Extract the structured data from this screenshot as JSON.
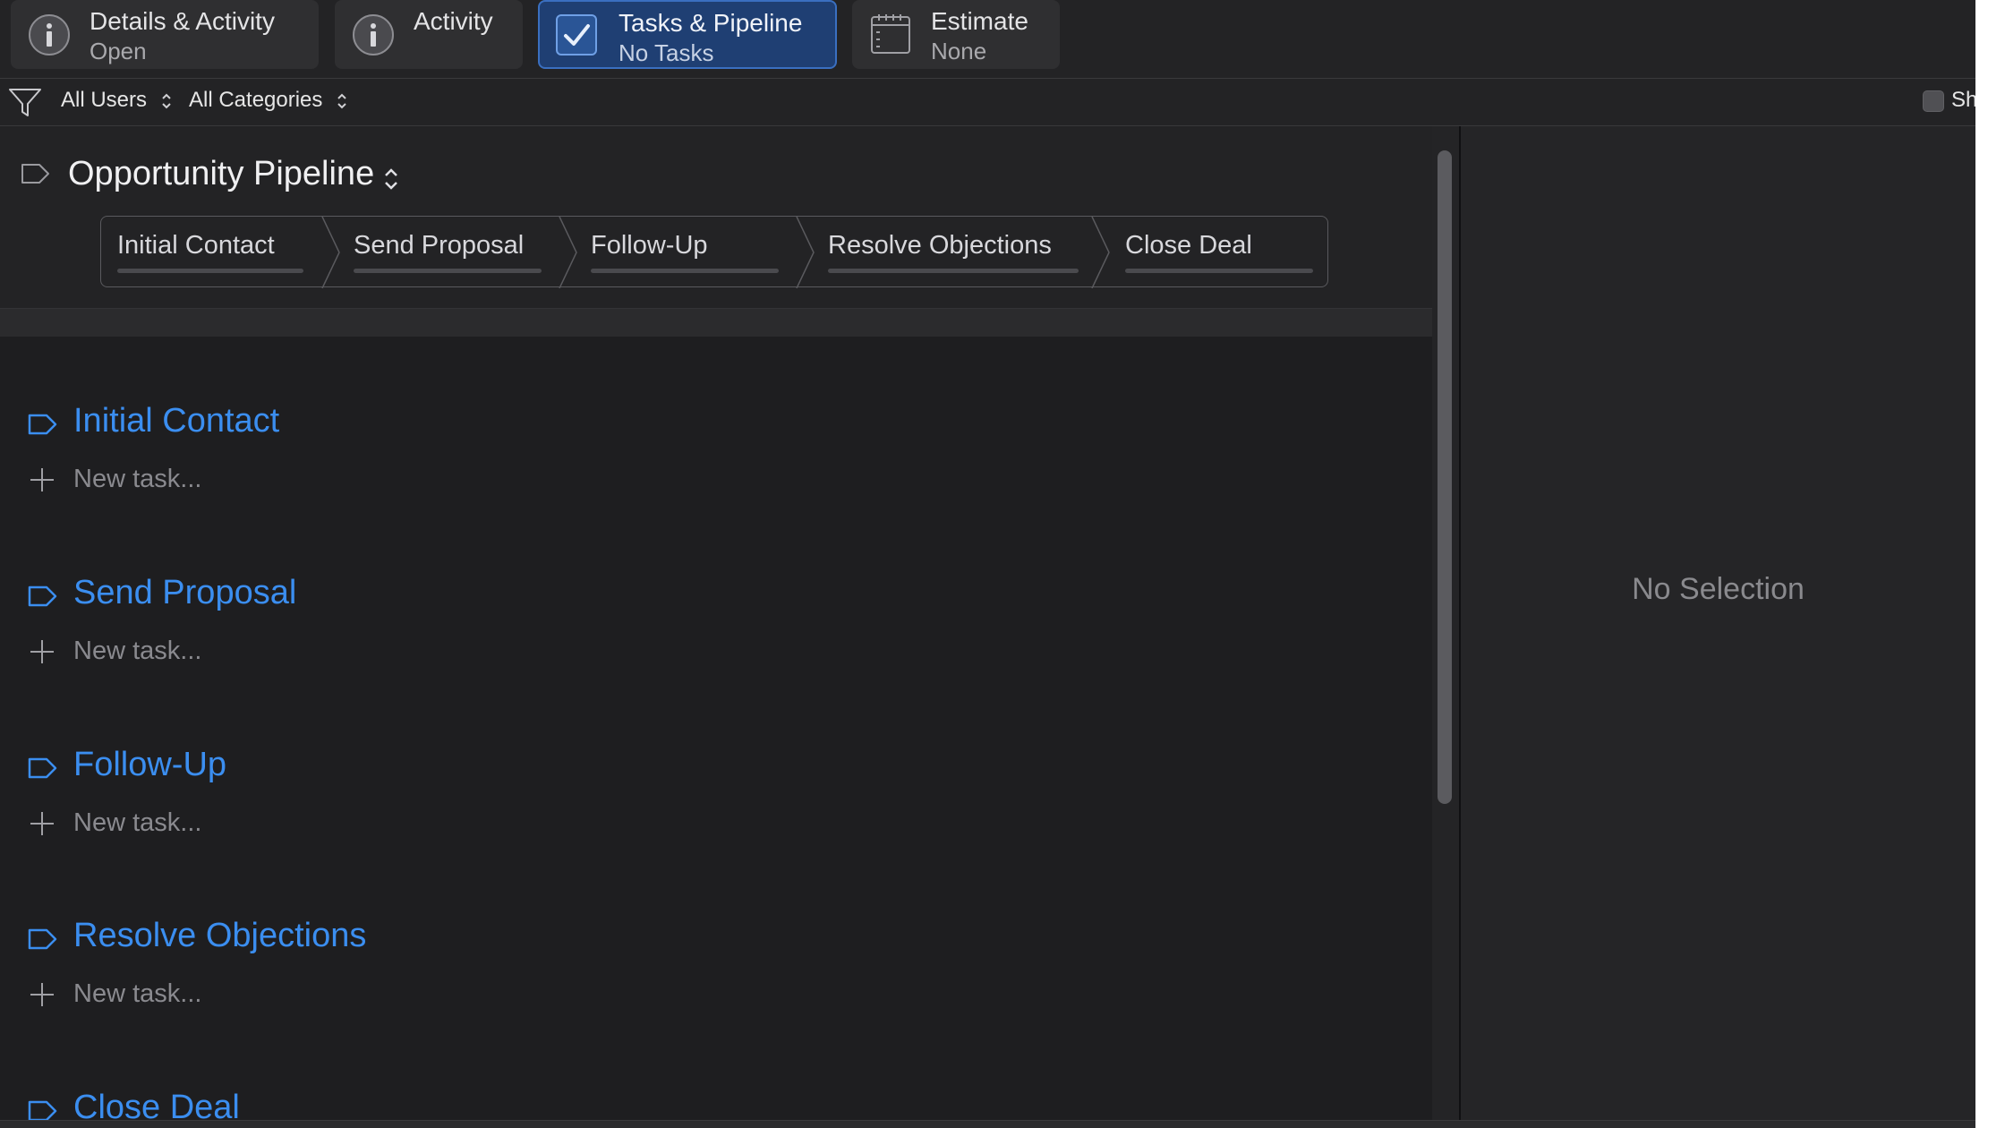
{
  "tabs": [
    {
      "title": "Details & Activity",
      "subtitle": "Open",
      "icon": "info-icon",
      "active": false
    },
    {
      "title": "Activity",
      "subtitle": "",
      "icon": "info-icon",
      "active": false
    },
    {
      "title": "Tasks & Pipeline",
      "subtitle": "No Tasks",
      "icon": "checkmark-icon",
      "active": true
    },
    {
      "title": "Estimate",
      "subtitle": "None",
      "icon": "calendar-icon",
      "active": false
    }
  ],
  "filters": {
    "users": "All Users",
    "categories": "All Categories",
    "show_label": "Sh"
  },
  "pipeline": {
    "title": "Opportunity Pipeline",
    "stages": [
      "Initial Contact",
      "Send Proposal",
      "Follow-Up",
      "Resolve Objections",
      "Close Deal"
    ]
  },
  "sections": [
    {
      "title": "Initial Contact",
      "new_task": "New task..."
    },
    {
      "title": "Send Proposal",
      "new_task": "New task..."
    },
    {
      "title": "Follow-Up",
      "new_task": "New task..."
    },
    {
      "title": "Resolve Objections",
      "new_task": "New task..."
    },
    {
      "title": "Close Deal",
      "new_task": ""
    }
  ],
  "inspector": {
    "empty_text": "No Selection"
  },
  "colors": {
    "accent": "#3b8ef0",
    "active_tab": "#1f3f73",
    "background": "#1e1e20"
  }
}
